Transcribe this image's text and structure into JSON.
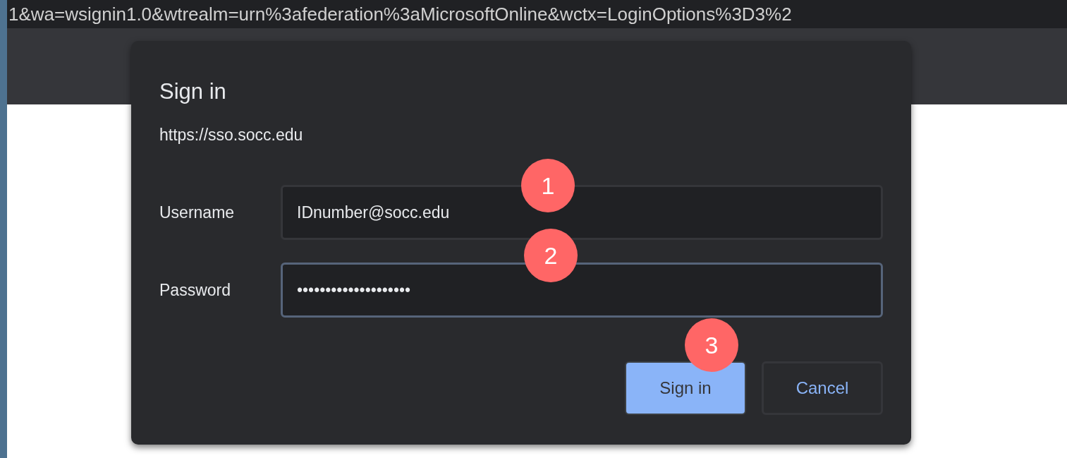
{
  "address_bar": {
    "url": "1&wa=wsignin1.0&wtrealm=urn%3afederation%3aMicrosoftOnline&wctx=LoginOptions%3D3%2"
  },
  "dialog": {
    "title": "Sign in",
    "origin": "https://sso.socc.edu",
    "fields": [
      {
        "label": "Username",
        "value": "IDnumber@socc.edu",
        "focused": false,
        "callout": "1"
      },
      {
        "label": "Password",
        "value": "••••••••••••••••••••",
        "focused": true,
        "callout": "2"
      }
    ],
    "buttons": [
      {
        "label": "Sign in",
        "kind": "primary",
        "callout": "3"
      },
      {
        "label": "Cancel",
        "kind": "secondary"
      }
    ]
  }
}
